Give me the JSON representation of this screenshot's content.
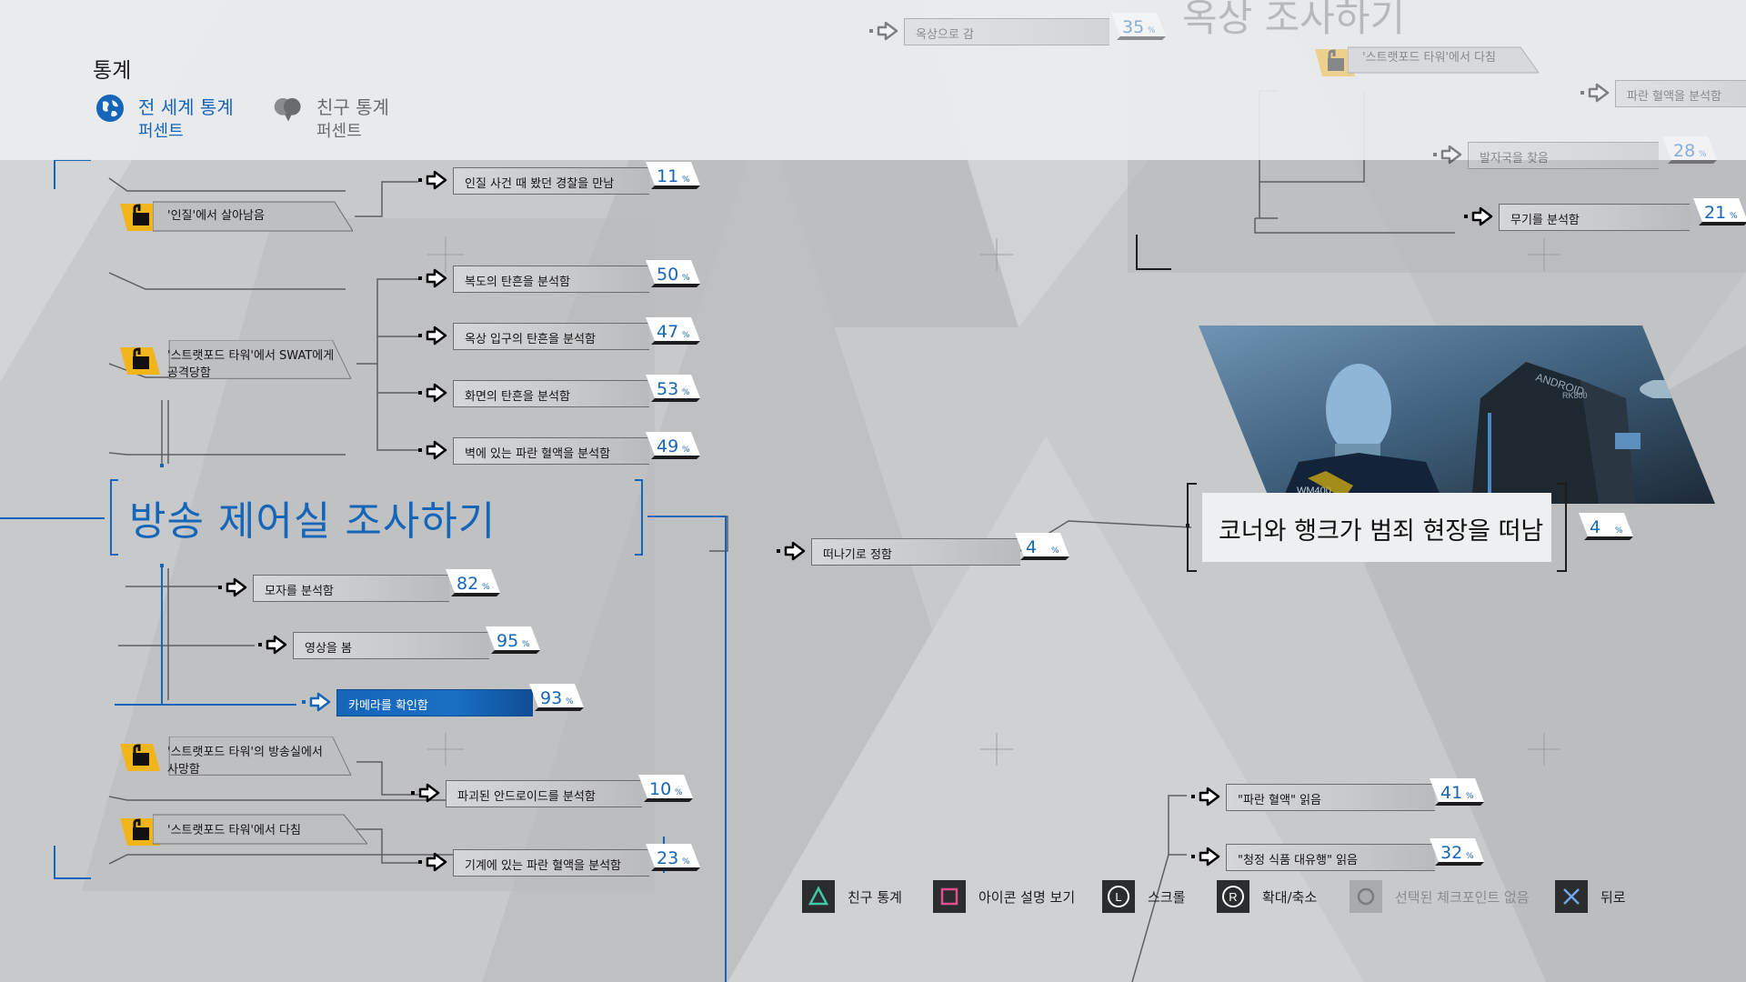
{
  "header": {
    "title": "통계",
    "tabs": [
      {
        "label": "전 세계 통계",
        "sub": "퍼센트"
      },
      {
        "label": "친구 통계",
        "sub": "퍼센트"
      }
    ]
  },
  "section": {
    "title": "방송 제어실 조사하기"
  },
  "locks": [
    {
      "text": [
        "'인질'에서 살아남음"
      ]
    },
    {
      "text": [
        "'스트랫포드 타워'에서 SWAT에게",
        "공격당함"
      ]
    },
    {
      "text": [
        "'스트랫포드 타워'의 방송실에서",
        "사망함"
      ]
    },
    {
      "text": [
        "'스트랫포드 타워'에서 다침"
      ]
    }
  ],
  "left_nodes": [
    {
      "label": "인질 사건 때 봤던 경찰을 만남",
      "pct": "11"
    },
    {
      "label": "복도의 탄흔을 분석함",
      "pct": "50"
    },
    {
      "label": "옥상 입구의 탄흔을 분석함",
      "pct": "47"
    },
    {
      "label": "화면의 탄흔을 분석함",
      "pct": "53"
    },
    {
      "label": "벽에 있는 파란 혈액을 분석함",
      "pct": "49"
    },
    {
      "label": "모자를 분석함",
      "pct": "82"
    },
    {
      "label": "영상을 봄",
      "pct": "95"
    },
    {
      "label": "카메라를 확인함",
      "pct": "93"
    },
    {
      "label": "파괴된 안드로이드를 분석함",
      "pct": "10"
    },
    {
      "label": "기계에 있는 파란 혈액을 분석함",
      "pct": "23"
    }
  ],
  "center_node": {
    "label": "떠나기로 정함",
    "pct": "4"
  },
  "main_node": {
    "label": "코너와 행크가 범죄 현장을 떠남",
    "pct": "4"
  },
  "right_nodes": [
    {
      "label": "\"파란 혈액\" 읽음",
      "pct": "41"
    },
    {
      "label": "\"청정 식품 대유행\" 읽음",
      "pct": "32"
    }
  ],
  "top_faded": {
    "title": "옥상 조사하기",
    "lock": "'스트랫포드 타워'에서 다침",
    "nodes": [
      {
        "label": "옥상으로 감",
        "pct": "35"
      },
      {
        "label": "파란 혈액을 분석함",
        "pct": ""
      },
      {
        "label": "발자국을 찾음",
        "pct": "28"
      },
      {
        "label": "무기를 분석함",
        "pct": "21"
      }
    ]
  },
  "scene_text": {
    "jacket": "ANDROID",
    "model": "RK800",
    "tag": "WM400"
  },
  "footer": [
    {
      "icon": "triangle-button",
      "label": "친구 통계"
    },
    {
      "icon": "square-button",
      "label": "아이콘 설명 보기"
    },
    {
      "icon": "l-stick",
      "label": "스크롤"
    },
    {
      "icon": "r-stick",
      "label": "확대/축소"
    },
    {
      "icon": "circle-button",
      "label": "선택된 체크포인트 없음"
    },
    {
      "icon": "cross-button",
      "label": "뒤로"
    }
  ],
  "colors": {
    "accent": "#1565b8",
    "lock": "#f2b41b",
    "bg": "#c9cacc"
  }
}
